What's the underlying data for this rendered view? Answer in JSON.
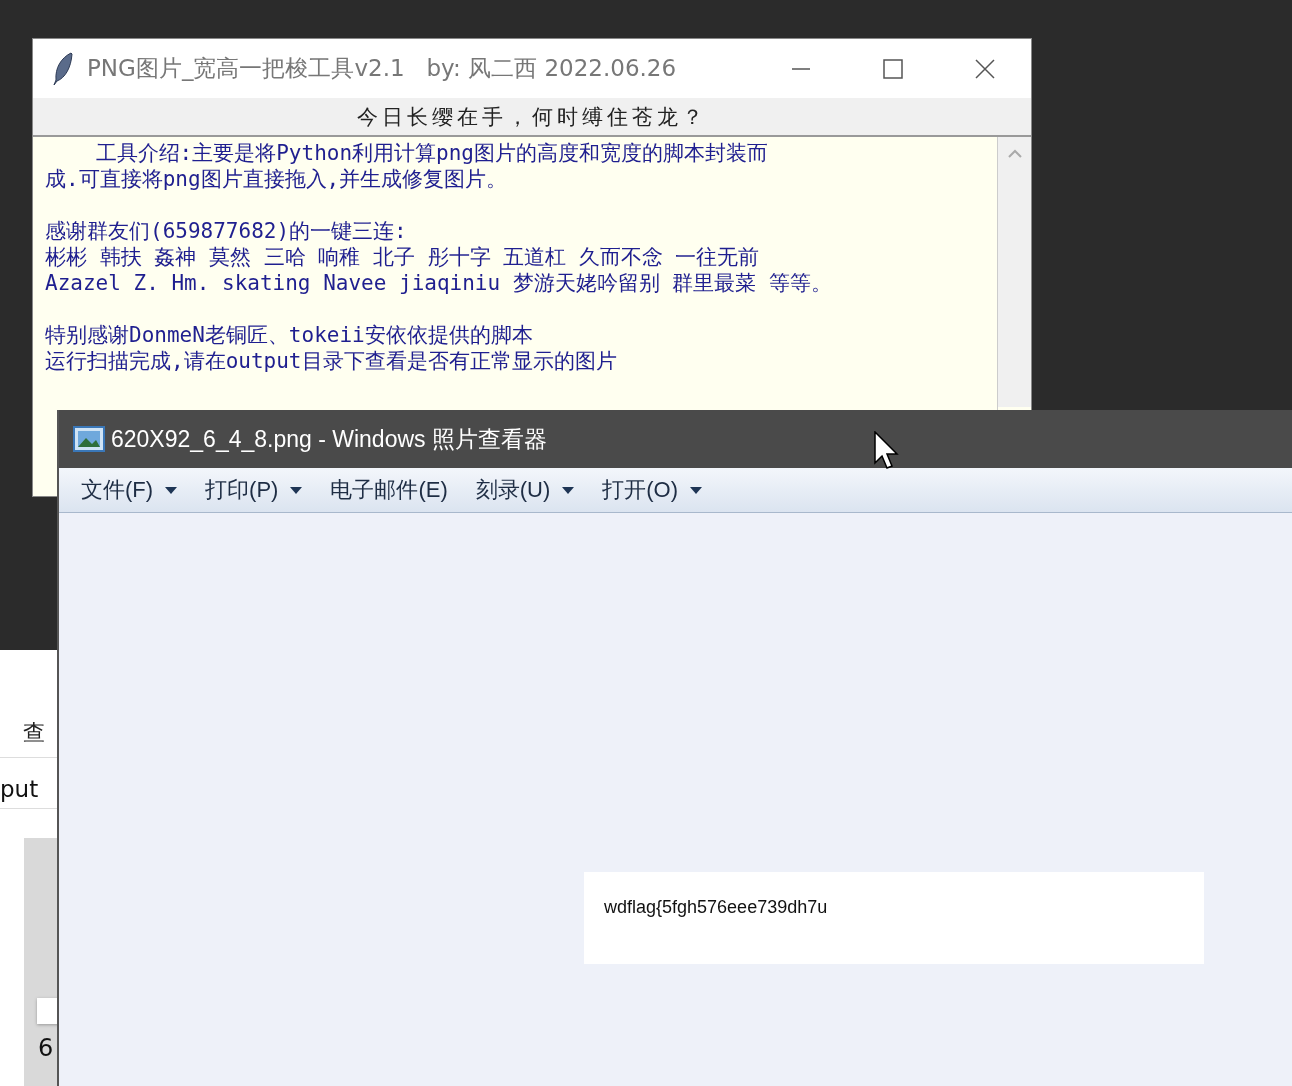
{
  "tool_window": {
    "title": "PNG图片_宽高一把梭工具v2.1   by: 风二西 2022.06.26",
    "heading": "今日长缨在手，何时缚住苍龙？",
    "paragraphs": [
      [
        "    工具介绍:主要是将Python利用计算png图片的高度和宽度的脚本封装而",
        "成.可直接将png图片直接拖入,并生成修复图片。"
      ],
      [
        "感谢群友们(659877682)的一键三连:",
        "彬彬 韩扶 姦神 莫然 三哈 响稚 北子 彤十字 五道杠 久而不念 一往无前",
        "Azazel Z. Hm. skating Navee jiaqiniu 梦游天姥吟留别 群里最菜 等等。"
      ],
      [
        "特别感谢DonmeN老铜匠、tokeii安依依提供的脚本",
        "运行扫描完成,请在output目录下查看是否有正常显示的图片"
      ]
    ]
  },
  "explorer_window": {
    "tab_label": "查",
    "path_text": "put",
    "file_label": "6"
  },
  "viewer_window": {
    "title": "620X92_6_4_8.png - Windows 照片查看器",
    "menu": [
      {
        "label": "文件(F)",
        "dropdown": true
      },
      {
        "label": "打印(P)",
        "dropdown": true
      },
      {
        "label": "电子邮件(E)",
        "dropdown": false
      },
      {
        "label": "刻录(U)",
        "dropdown": true
      },
      {
        "label": "打开(O)",
        "dropdown": true
      }
    ],
    "image_text": "wdflag{5fgh576eee739dh7u"
  }
}
